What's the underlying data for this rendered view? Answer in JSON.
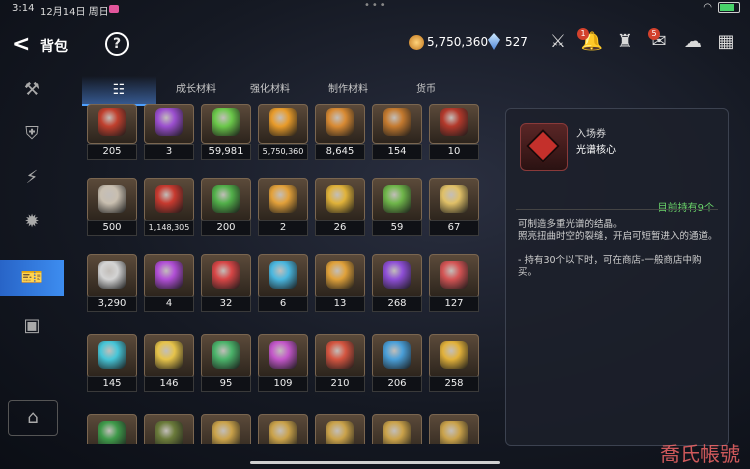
{
  "statusbar": {
    "time": "3:14",
    "date": "12月14日 周日",
    "dots": "•••"
  },
  "header": {
    "title": "背包",
    "gold": "5,750,360",
    "gems": "527",
    "badge_bell": "1",
    "badge_mail": "5"
  },
  "tabs": [
    {
      "label": "☷",
      "active": true
    },
    {
      "label": "成长材料"
    },
    {
      "label": "强化材料"
    },
    {
      "label": "制作材料"
    },
    {
      "label": "货币"
    }
  ],
  "items": [
    [
      "205",
      "3",
      "59,981",
      "5,750,360",
      "8,645",
      "154",
      "10"
    ],
    [
      "500",
      "1,148,305",
      "200",
      "2",
      "26",
      "59",
      "67"
    ],
    [
      "3,290",
      "4",
      "32",
      "6",
      "13",
      "268",
      "127"
    ],
    [
      "145",
      "146",
      "95",
      "109",
      "210",
      "206",
      "258"
    ],
    [
      "",
      "",
      "",
      "",
      "",
      "",
      ""
    ]
  ],
  "item_colors": [
    [
      "#c0402e",
      "#9b4fcf",
      "#6bc84a",
      "#e89b2a",
      "#d88a33",
      "#c47a2f",
      "#b3392b"
    ],
    [
      "#c9bfb0",
      "#c73a2f",
      "#52b04a",
      "#e3a13a",
      "#e0b23a",
      "#6fb64a",
      "#e0c067"
    ],
    [
      "#d4d4d4",
      "#b14fd6",
      "#d74646",
      "#4ab7df",
      "#e0a13a",
      "#8e4fd6",
      "#d45454"
    ],
    [
      "#47c6d8",
      "#e6c34a",
      "#4bb36a",
      "#c357c9",
      "#d45540",
      "#4a9fd8",
      "#e2b13a"
    ],
    [
      "#3f9a4a",
      "#6a7a3a",
      "#caa24a",
      "#caa24a",
      "#caa24a",
      "#caa24a",
      "#caa24a"
    ]
  ],
  "detail": {
    "type": "入场券",
    "name": "光谱核心",
    "owned": "目前持有9个",
    "description": "可制造多重光谱的结晶。\n照亮扭曲时空的裂缝，开启可短暂进入的通道。\n\n- 持有30个以下时，可在商店-一般商店中购买。"
  },
  "watermark": "喬氏帳號"
}
